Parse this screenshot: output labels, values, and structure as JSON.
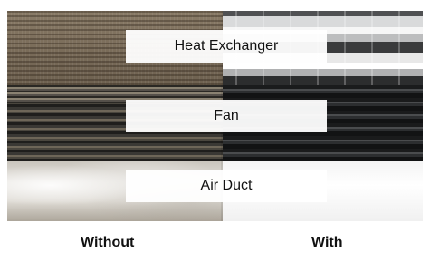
{
  "labels": {
    "heat_exchanger": "Heat Exchanger",
    "fan": "Fan",
    "air_duct": "Air Duct"
  },
  "captions": {
    "without": "Without",
    "with": "With"
  }
}
